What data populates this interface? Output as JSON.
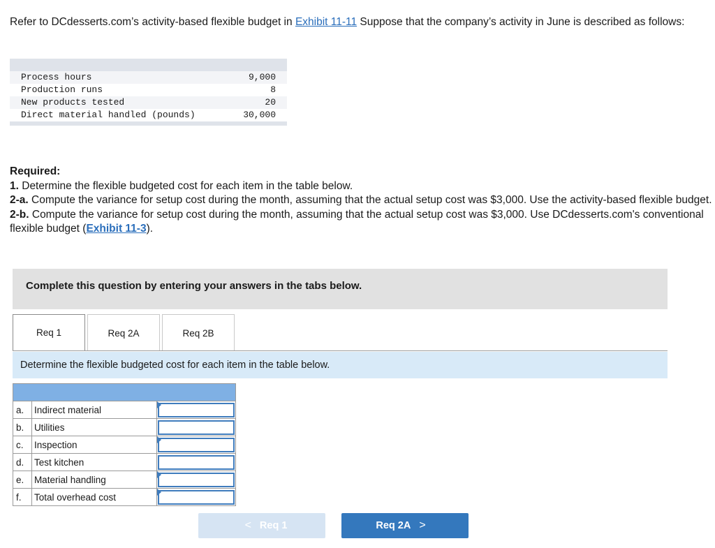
{
  "intro": {
    "text_before": "Refer to DCdesserts.com’s activity-based flexible budget in ",
    "link": "Exhibit 11-11",
    "text_after": " Suppose that the company’s activity in June is described as follows:"
  },
  "activity_table": [
    {
      "label": "Process hours",
      "value": "9,000"
    },
    {
      "label": "Production runs",
      "value": "8"
    },
    {
      "label": "New products tested",
      "value": "20"
    },
    {
      "label": "Direct material handled (pounds)",
      "value": "30,000"
    }
  ],
  "required": {
    "heading": "Required:",
    "item1_num": "1.",
    "item1_text": " Determine the flexible budgeted cost for each item in the table below.",
    "item2a_num": "2-a.",
    "item2a_text": " Compute the variance for setup cost during the month, assuming that the actual setup cost was $3,000. Use the activity-based flexible budget.",
    "item2b_num": "2-b.",
    "item2b_text": " Compute the variance for setup cost during the month, assuming that the actual setup cost was $3,000. Use DCdesserts.com's conventional flexible budget (",
    "item2b_link": "Exhibit 11-3",
    "item2b_end": ")."
  },
  "complete_box": "Complete this question by entering your answers in the tabs below.",
  "tabs": [
    "Req 1",
    "Req 2A",
    "Req 2B"
  ],
  "instruction": "Determine the flexible budgeted cost for each item in the table below.",
  "answer_rows": [
    {
      "letter": "a.",
      "label": "Indirect material",
      "value": ""
    },
    {
      "letter": "b.",
      "label": "Utilities",
      "value": ""
    },
    {
      "letter": "c.",
      "label": "Inspection",
      "value": ""
    },
    {
      "letter": "d.",
      "label": "Test kitchen",
      "value": ""
    },
    {
      "letter": "e.",
      "label": "Material handling",
      "value": ""
    },
    {
      "letter": "f.",
      "label": "Total overhead cost",
      "value": ""
    }
  ],
  "nav": {
    "prev_label": "Req 1",
    "next_label": "Req 2A",
    "prev_chevron": "<",
    "next_chevron": ">"
  }
}
